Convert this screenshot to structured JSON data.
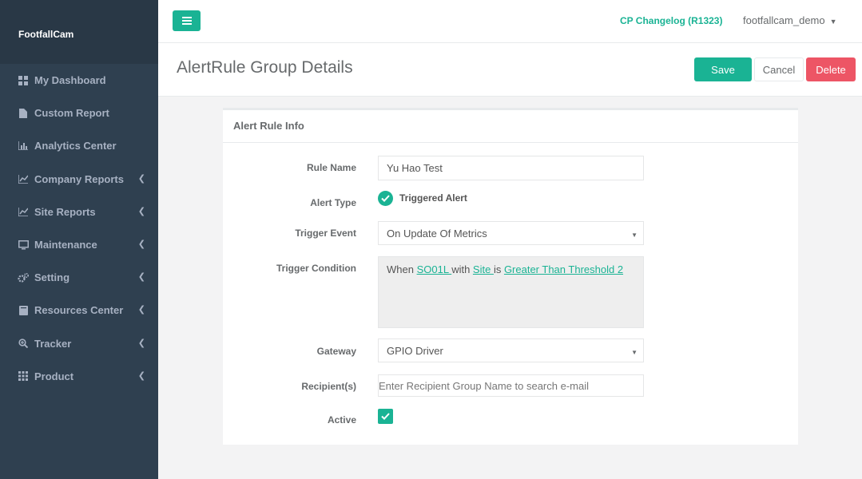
{
  "app": {
    "brand": "FootfallCam"
  },
  "sidebar": {
    "items": [
      {
        "label": "My Dashboard",
        "icon": "dashboard-grid-icon",
        "has_children": false
      },
      {
        "label": "Custom Report",
        "icon": "file-icon",
        "has_children": false
      },
      {
        "label": "Analytics Center",
        "icon": "bar-chart-icon",
        "has_children": false
      },
      {
        "label": "Company Reports",
        "icon": "line-chart-icon",
        "has_children": true
      },
      {
        "label": "Site Reports",
        "icon": "line-chart-icon",
        "has_children": true
      },
      {
        "label": "Maintenance",
        "icon": "monitor-icon",
        "has_children": true
      },
      {
        "label": "Setting",
        "icon": "gears-icon",
        "has_children": true
      },
      {
        "label": "Resources Center",
        "icon": "book-icon",
        "has_children": true
      },
      {
        "label": "Tracker",
        "icon": "search-plus-icon",
        "has_children": true
      },
      {
        "label": "Product",
        "icon": "grid-icon",
        "has_children": true
      }
    ]
  },
  "topbar": {
    "changelog": "CP Changelog (R1323)",
    "user": "footfallcam_demo"
  },
  "page": {
    "title": "AlertRule Group Details",
    "save_label": "Save",
    "cancel_label": "Cancel",
    "delete_label": "Delete"
  },
  "panel": {
    "title": "Alert Rule Info",
    "rule_name_label": "Rule Name",
    "rule_name_value": "Yu Hao Test",
    "alert_type_label": "Alert Type",
    "alert_type_value": "Triggered Alert",
    "trigger_event_label": "Trigger Event",
    "trigger_event_value": "On Update Of Metrics",
    "trigger_condition_label": "Trigger Condition",
    "condition": {
      "t1": "When ",
      "link1": "SO01L ",
      "t2": "with ",
      "link2": "Site ",
      "t3": "is ",
      "link3": "Greater Than Threshold 2"
    },
    "gateway_label": "Gateway",
    "gateway_value": "GPIO Driver",
    "recipients_label": "Recipient(s)",
    "recipients_placeholder": "Enter Recipient Group Name to search e-mail",
    "active_label": "Active",
    "active_checked": true
  },
  "colors": {
    "accent": "#1ab394",
    "danger": "#ed5565",
    "sidebar": "#2f4050"
  }
}
